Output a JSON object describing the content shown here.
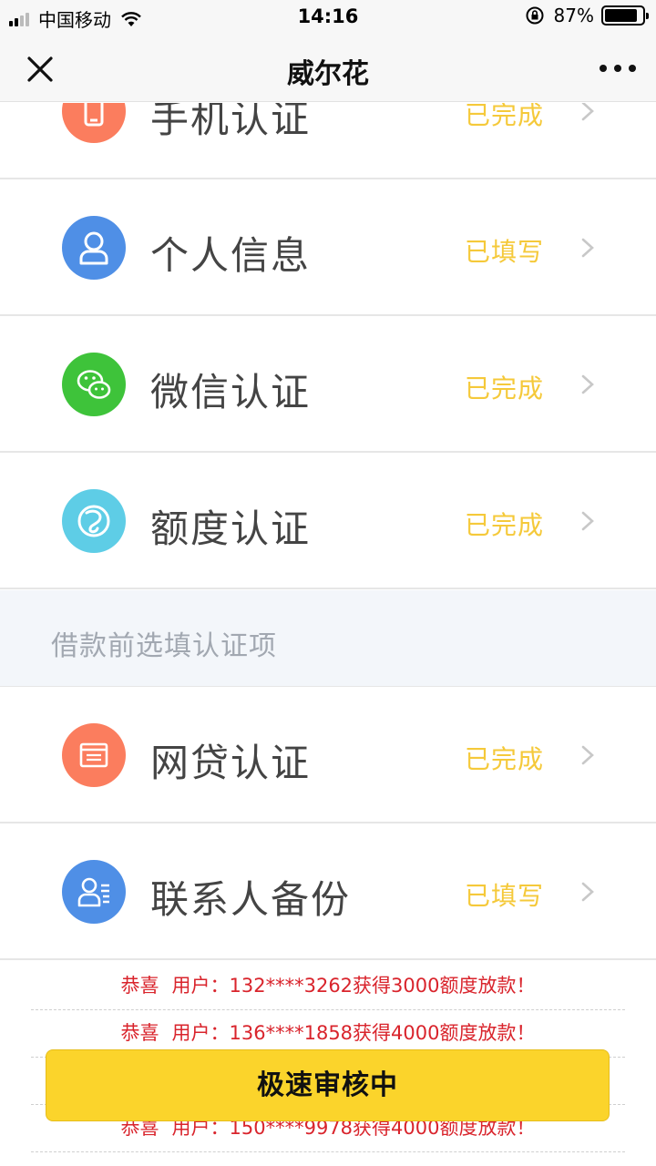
{
  "status_bar": {
    "carrier": "中国移动",
    "time": "14:16",
    "battery_percent": "87%",
    "battery_level": 0.87
  },
  "nav": {
    "title": "威尔花",
    "close_icon": "close-icon",
    "more_icon": "more-dots-icon"
  },
  "items": [
    {
      "title": "手机认证",
      "status": "已完成",
      "icon": "phone-icon",
      "color": "#fb7d5e"
    },
    {
      "title": "个人信息",
      "status": "已填写",
      "icon": "person-icon",
      "color": "#4f8fe6"
    },
    {
      "title": "微信认证",
      "status": "已完成",
      "icon": "wechat-icon",
      "color": "#3ec33a"
    },
    {
      "title": "额度认证",
      "status": "已完成",
      "icon": "quota-icon",
      "color": "#5ecde6"
    }
  ],
  "section": {
    "title": "借款前选填认证项"
  },
  "optional_items": [
    {
      "title": "网贷认证",
      "status": "已完成",
      "icon": "card-icon",
      "color": "#fb7d5e"
    },
    {
      "title": "联系人备份",
      "status": "已填写",
      "icon": "contacts-icon",
      "color": "#4f8fe6"
    }
  ],
  "ticker": [
    {
      "prefix": "恭喜",
      "text": "用户：132****3262获得3000额度放款！"
    },
    {
      "prefix": "恭喜",
      "text": "用户：136****1858获得4000额度放款！"
    },
    {
      "prefix": "恭喜",
      "text": "用户：150****9978获得4000额度放款！"
    }
  ],
  "button": {
    "label": "极速审核中"
  },
  "colors": {
    "status_yellow": "#f5c93a",
    "ticker_red": "#d9242c",
    "button_yellow": "#fbd42b"
  }
}
